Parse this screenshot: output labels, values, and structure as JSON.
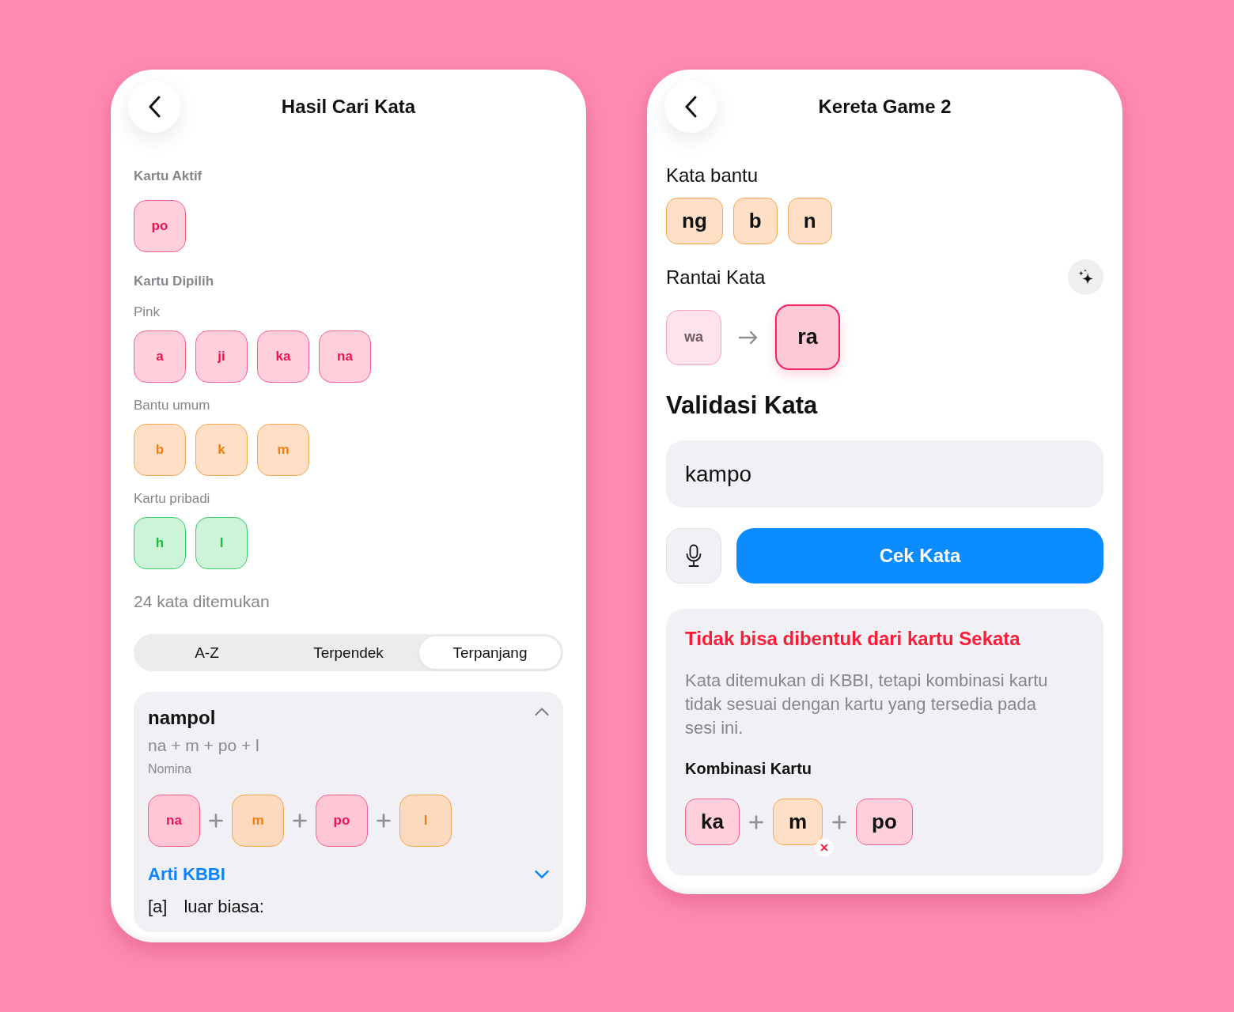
{
  "left_screen": {
    "title": "Hasil Cari Kata",
    "active_section": {
      "label": "Kartu Aktif",
      "cards": [
        {
          "text": "po",
          "kind": "pink"
        }
      ]
    },
    "selected_section": {
      "label": "Kartu Dipilih",
      "groups": [
        {
          "label": "Pink",
          "cards": [
            {
              "text": "a",
              "kind": "pink"
            },
            {
              "text": "ji",
              "kind": "pink"
            },
            {
              "text": "ka",
              "kind": "pink"
            },
            {
              "text": "na",
              "kind": "pink"
            }
          ]
        },
        {
          "label": "Bantu umum",
          "cards": [
            {
              "text": "b",
              "kind": "helper"
            },
            {
              "text": "k",
              "kind": "helper"
            },
            {
              "text": "m",
              "kind": "helper"
            }
          ]
        },
        {
          "label": "Kartu pribadi",
          "cards": [
            {
              "text": "h",
              "kind": "personal"
            },
            {
              "text": "l",
              "kind": "personal"
            }
          ]
        }
      ]
    },
    "found_count": "24 kata ditemukan",
    "sort_tabs": [
      {
        "label": "A-Z",
        "selected": false
      },
      {
        "label": "Terpendek",
        "selected": false
      },
      {
        "label": "Terpanjang",
        "selected": true
      }
    ],
    "result": {
      "word": "nampol",
      "expanded": true,
      "formula": "na + m + po + l",
      "word_class": "Nomina",
      "cards": [
        {
          "text": "na",
          "kind": "pink"
        },
        {
          "text": "m",
          "kind": "helper"
        },
        {
          "text": "po",
          "kind": "pink"
        },
        {
          "text": "l",
          "kind": "helper"
        }
      ],
      "meaning_label": "Arti KBBI",
      "definitions": [
        {
          "marker": "[a]",
          "text": "luar biasa:"
        }
      ]
    }
  },
  "right_screen": {
    "title": "Kereta Game 2",
    "helper_section": {
      "label": "Kata bantu",
      "cards": [
        {
          "text": "ng",
          "kind": "helper"
        },
        {
          "text": "b",
          "kind": "helper"
        },
        {
          "text": "n",
          "kind": "helper"
        }
      ]
    },
    "chain_section": {
      "label": "Rantai Kata",
      "cards": [
        {
          "text": "wa",
          "kind": "pink",
          "current": false
        },
        {
          "text": "ra",
          "kind": "pink",
          "current": true
        }
      ]
    },
    "validation": {
      "heading": "Validasi Kata",
      "input_value": "kampo",
      "submit_label": "Cek Kata"
    },
    "error": {
      "title": "Tidak bisa dibentuk dari kartu Sekata",
      "message": "Kata ditemukan di KBBI, tetapi kombinasi kartu tidak sesuai dengan kartu yang tersedia pada sesi ini.",
      "combination_label": "Kombinasi Kartu",
      "cards": [
        {
          "text": "ka",
          "kind": "pink",
          "invalid": false
        },
        {
          "text": "m",
          "kind": "helper",
          "invalid": true
        },
        {
          "text": "po",
          "kind": "pink",
          "invalid": false
        }
      ]
    }
  }
}
